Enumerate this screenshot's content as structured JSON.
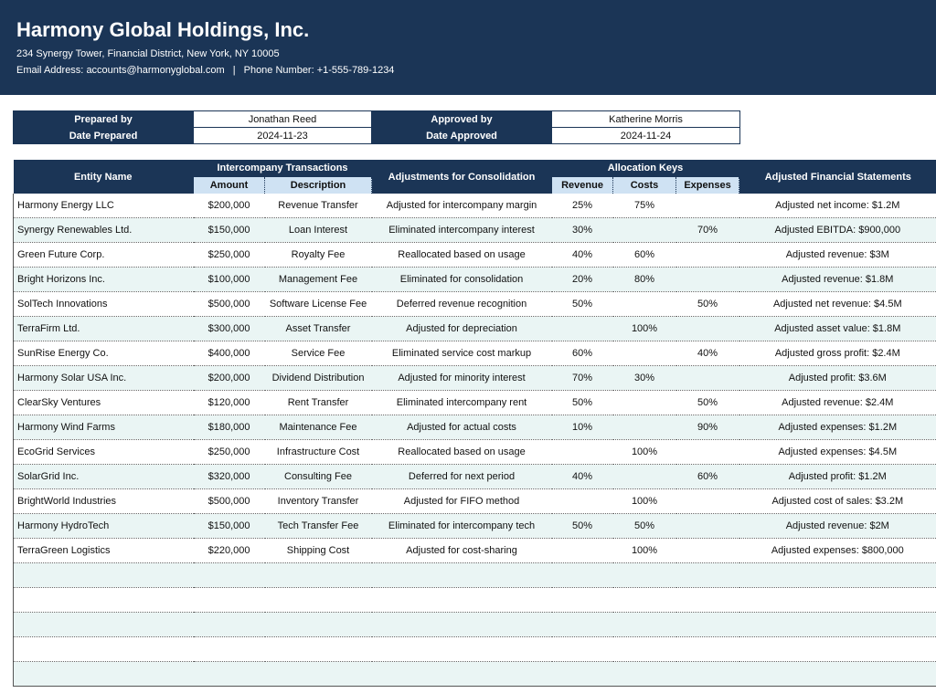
{
  "company": {
    "name": "Harmony Global Holdings, Inc.",
    "address": "234 Synergy Tower, Financial District, New York, NY 10005",
    "email_label": "Email Address:",
    "email": "accounts@harmonyglobal.com",
    "separator": "|",
    "phone_label": "Phone Number:",
    "phone": "+1-555-789-1234"
  },
  "meta": {
    "prepared_by_label": "Prepared by",
    "prepared_by": "Jonathan Reed",
    "approved_by_label": "Approved by",
    "approved_by": "Katherine Morris",
    "date_prepared_label": "Date Prepared",
    "date_prepared": "2024-11-23",
    "date_approved_label": "Date Approved",
    "date_approved": "2024-11-24"
  },
  "table": {
    "headers": {
      "entity": "Entity Name",
      "intercompany": "Intercompany Transactions",
      "amount": "Amount",
      "description": "Description",
      "adjustments": "Adjustments for Consolidation",
      "allocation": "Allocation Keys",
      "revenue": "Revenue",
      "costs": "Costs",
      "expenses": "Expenses",
      "statements": "Adjusted Financial Statements"
    },
    "rows": [
      {
        "entity": "Harmony Energy LLC",
        "amount": "$200,000",
        "description": "Revenue Transfer",
        "adjustment": "Adjusted for intercompany margin",
        "revenue": "25%",
        "costs": "75%",
        "expenses": "",
        "statement": "Adjusted net income: $1.2M"
      },
      {
        "entity": "Synergy Renewables Ltd.",
        "amount": "$150,000",
        "description": "Loan Interest",
        "adjustment": "Eliminated intercompany interest",
        "revenue": "30%",
        "costs": "",
        "expenses": "70%",
        "statement": "Adjusted EBITDA: $900,000"
      },
      {
        "entity": "Green Future Corp.",
        "amount": "$250,000",
        "description": "Royalty Fee",
        "adjustment": "Reallocated based on usage",
        "revenue": "40%",
        "costs": "60%",
        "expenses": "",
        "statement": "Adjusted revenue: $3M"
      },
      {
        "entity": "Bright Horizons Inc.",
        "amount": "$100,000",
        "description": "Management Fee",
        "adjustment": "Eliminated for consolidation",
        "revenue": "20%",
        "costs": "80%",
        "expenses": "",
        "statement": "Adjusted revenue: $1.8M"
      },
      {
        "entity": "SolTech Innovations",
        "amount": "$500,000",
        "description": "Software License Fee",
        "adjustment": "Deferred revenue recognition",
        "revenue": "50%",
        "costs": "",
        "expenses": "50%",
        "statement": "Adjusted net revenue: $4.5M"
      },
      {
        "entity": "TerraFirm Ltd.",
        "amount": "$300,000",
        "description": "Asset Transfer",
        "adjustment": "Adjusted for depreciation",
        "revenue": "",
        "costs": "100%",
        "expenses": "",
        "statement": "Adjusted asset value: $1.8M"
      },
      {
        "entity": "SunRise Energy Co.",
        "amount": "$400,000",
        "description": "Service Fee",
        "adjustment": "Eliminated service cost markup",
        "revenue": "60%",
        "costs": "",
        "expenses": "40%",
        "statement": "Adjusted gross profit: $2.4M"
      },
      {
        "entity": "Harmony Solar USA Inc.",
        "amount": "$200,000",
        "description": "Dividend Distribution",
        "adjustment": "Adjusted for minority interest",
        "revenue": "70%",
        "costs": "30%",
        "expenses": "",
        "statement": "Adjusted profit: $3.6M"
      },
      {
        "entity": "ClearSky Ventures",
        "amount": "$120,000",
        "description": "Rent Transfer",
        "adjustment": "Eliminated intercompany rent",
        "revenue": "50%",
        "costs": "",
        "expenses": "50%",
        "statement": "Adjusted revenue: $2.4M"
      },
      {
        "entity": "Harmony Wind Farms",
        "amount": "$180,000",
        "description": "Maintenance Fee",
        "adjustment": "Adjusted for actual costs",
        "revenue": "10%",
        "costs": "",
        "expenses": "90%",
        "statement": "Adjusted expenses: $1.2M"
      },
      {
        "entity": "EcoGrid Services",
        "amount": "$250,000",
        "description": "Infrastructure Cost",
        "adjustment": "Reallocated based on usage",
        "revenue": "",
        "costs": "100%",
        "expenses": "",
        "statement": "Adjusted expenses: $4.5M"
      },
      {
        "entity": "SolarGrid Inc.",
        "amount": "$320,000",
        "description": "Consulting Fee",
        "adjustment": "Deferred for next period",
        "revenue": "40%",
        "costs": "",
        "expenses": "60%",
        "statement": "Adjusted profit: $1.2M"
      },
      {
        "entity": "BrightWorld Industries",
        "amount": "$500,000",
        "description": "Inventory Transfer",
        "adjustment": "Adjusted for FIFO method",
        "revenue": "",
        "costs": "100%",
        "expenses": "",
        "statement": "Adjusted cost of sales: $3.2M"
      },
      {
        "entity": "Harmony HydroTech",
        "amount": "$150,000",
        "description": "Tech Transfer Fee",
        "adjustment": "Eliminated for intercompany tech",
        "revenue": "50%",
        "costs": "50%",
        "expenses": "",
        "statement": "Adjusted revenue: $2M"
      },
      {
        "entity": "TerraGreen Logistics",
        "amount": "$220,000",
        "description": "Shipping Cost",
        "adjustment": "Adjusted for cost-sharing",
        "revenue": "",
        "costs": "100%",
        "expenses": "",
        "statement": "Adjusted expenses: $800,000"
      },
      {
        "entity": "",
        "amount": "",
        "description": "",
        "adjustment": "",
        "revenue": "",
        "costs": "",
        "expenses": "",
        "statement": ""
      },
      {
        "entity": "",
        "amount": "",
        "description": "",
        "adjustment": "",
        "revenue": "",
        "costs": "",
        "expenses": "",
        "statement": ""
      },
      {
        "entity": "",
        "amount": "",
        "description": "",
        "adjustment": "",
        "revenue": "",
        "costs": "",
        "expenses": "",
        "statement": ""
      },
      {
        "entity": "",
        "amount": "",
        "description": "",
        "adjustment": "",
        "revenue": "",
        "costs": "",
        "expenses": "",
        "statement": ""
      },
      {
        "entity": "",
        "amount": "",
        "description": "",
        "adjustment": "",
        "revenue": "",
        "costs": "",
        "expenses": "",
        "statement": ""
      }
    ]
  },
  "colors": {
    "header_bg": "#1b3556",
    "subheader_bg": "#cfe2f3",
    "row_alt_bg": "#eaf5f4"
  }
}
